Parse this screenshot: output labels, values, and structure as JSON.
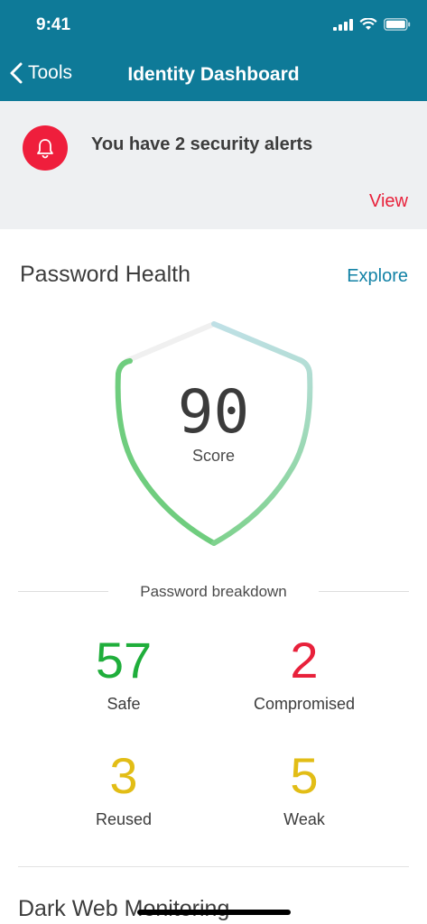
{
  "status_bar": {
    "time": "9:41"
  },
  "nav": {
    "back_label": "Tools",
    "title": "Identity Dashboard"
  },
  "alert": {
    "text": "You have 2 security alerts",
    "action": "View",
    "accent": "#ef1e3c"
  },
  "password_health": {
    "title": "Password Health",
    "explore": "Explore",
    "score": "90",
    "score_label": "Score",
    "breakdown_label": "Password breakdown",
    "stats": [
      {
        "value": "57",
        "label": "Safe",
        "color": "#1fae3b"
      },
      {
        "value": "2",
        "label": "Compromised",
        "color": "#e8213b"
      },
      {
        "value": "3",
        "label": "Reused",
        "color": "#e2bd16"
      },
      {
        "value": "5",
        "label": "Weak",
        "color": "#e2bd16"
      }
    ]
  },
  "dark_web": {
    "title": "Dark Web Monitoring"
  },
  "colors": {
    "header": "#0e7a98",
    "link": "#1282a6"
  }
}
